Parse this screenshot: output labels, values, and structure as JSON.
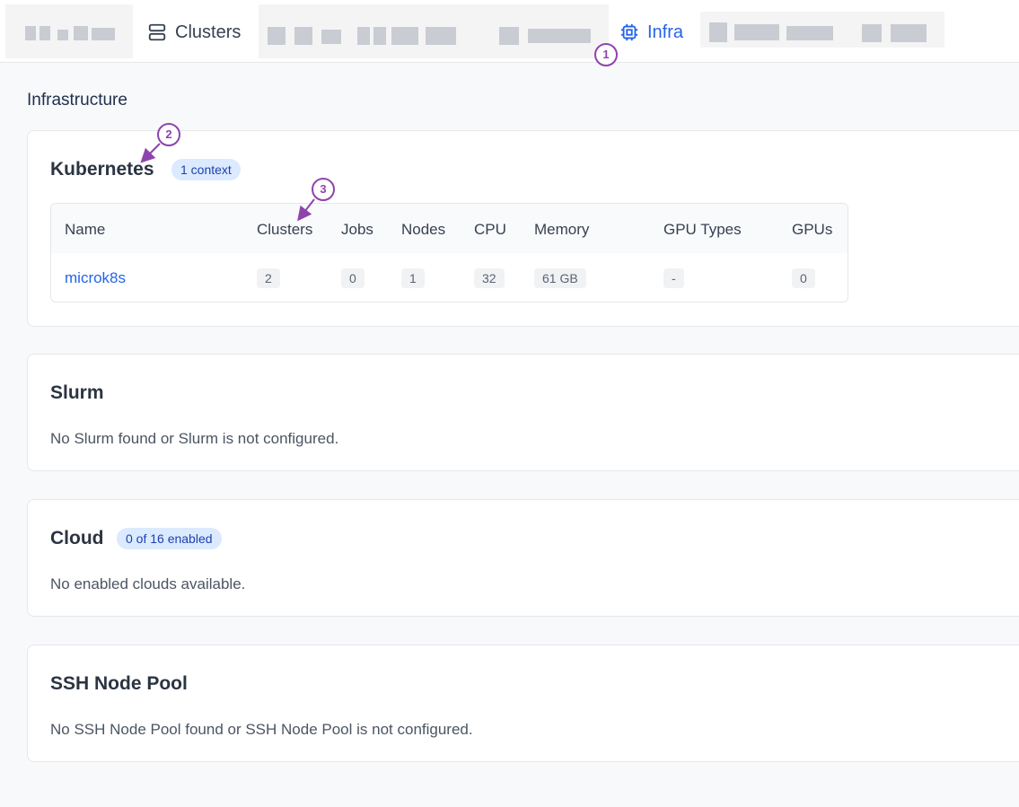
{
  "nav": {
    "clusters_label": "Clusters",
    "infra_label": "Infra"
  },
  "page": {
    "title": "Infrastructure"
  },
  "kubernetes": {
    "title": "Kubernetes",
    "badge": "1 context",
    "columns": [
      "Name",
      "Clusters",
      "Jobs",
      "Nodes",
      "CPU",
      "Memory",
      "GPU Types",
      "GPUs"
    ],
    "rows": [
      {
        "name": "microk8s",
        "clusters": "2",
        "jobs": "0",
        "nodes": "1",
        "cpu": "32",
        "memory": "61 GB",
        "gpu_types": "-",
        "gpus": "0"
      }
    ]
  },
  "slurm": {
    "title": "Slurm",
    "message": "No Slurm found or Slurm is not configured."
  },
  "cloud": {
    "title": "Cloud",
    "badge": "0 of 16 enabled",
    "message": "No enabled clouds available."
  },
  "ssh": {
    "title": "SSH Node Pool",
    "message": "No SSH Node Pool found or SSH Node Pool is not configured."
  },
  "annotations": [
    "1",
    "2",
    "3"
  ],
  "colors": {
    "accent": "#2563eb",
    "annotation": "#8e44ad",
    "badge_bg": "#dbeafe"
  }
}
